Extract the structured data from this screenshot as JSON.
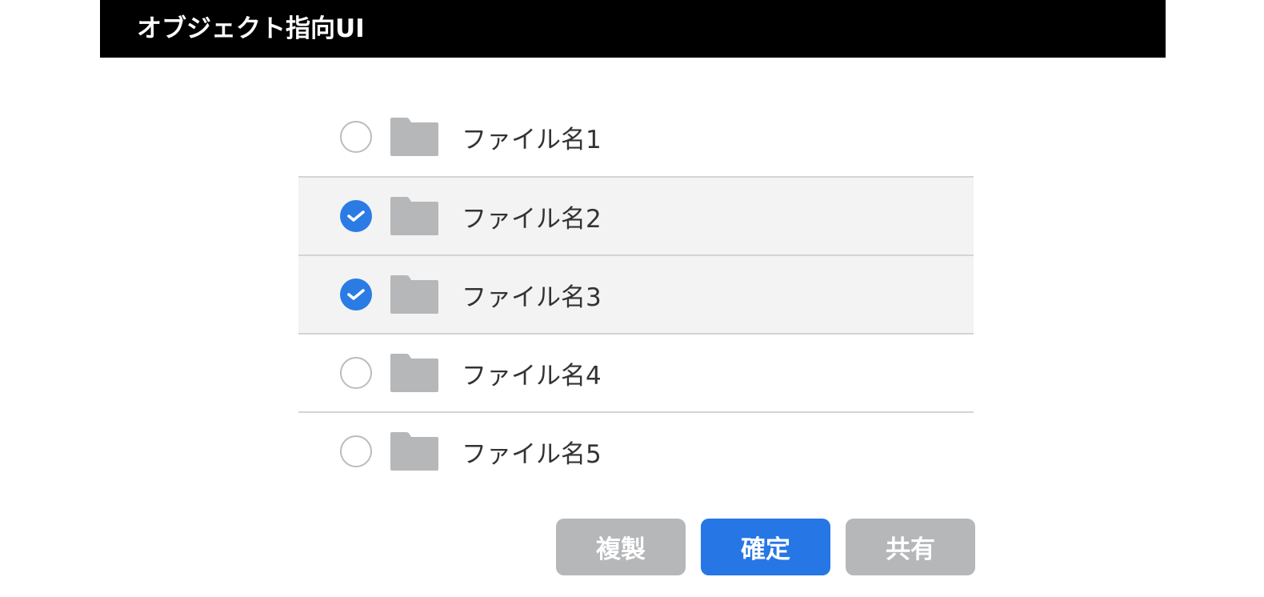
{
  "header": {
    "title": "オブジェクト指向UI"
  },
  "files": [
    {
      "name": "ファイル名1",
      "selected": false
    },
    {
      "name": "ファイル名2",
      "selected": true
    },
    {
      "name": "ファイル名3",
      "selected": true
    },
    {
      "name": "ファイル名4",
      "selected": false
    },
    {
      "name": "ファイル名5",
      "selected": false
    }
  ],
  "buttons": {
    "duplicate": "複製",
    "confirm": "確定",
    "share": "共有"
  },
  "icons": {
    "file_icon": "folder-icon",
    "selection_icon": "check-icon"
  },
  "colors": {
    "header_bg": "#000000",
    "accent": "#2b7be5",
    "primary_button": "#2776e6",
    "secondary_button": "#b6b7b9",
    "folder": "#b6b7b9",
    "selected_row_bg": "#f3f3f3"
  }
}
